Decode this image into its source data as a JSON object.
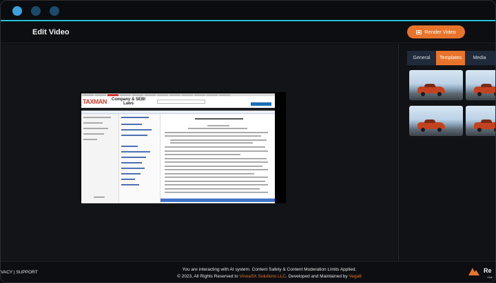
{
  "window": {
    "controls": [
      "close",
      "minimize",
      "maximize"
    ]
  },
  "header": {
    "title": "Edit Video",
    "render_label": "Render Video"
  },
  "preview": {
    "site": {
      "logo": "TAXMAN",
      "title_line1": "Company & SEBI",
      "title_line2": "Laws"
    }
  },
  "panel": {
    "tabs": [
      {
        "label": "General",
        "active": false
      },
      {
        "label": "Templates",
        "active": true
      },
      {
        "label": "Media",
        "active": false
      }
    ],
    "templates": [
      {
        "icon": "car-thumbnail"
      },
      {
        "icon": "car-thumbnail"
      },
      {
        "icon": "car-thumbnail"
      },
      {
        "icon": "car-thumbnail"
      }
    ]
  },
  "footer": {
    "links": "VACY | SUPPORT",
    "line1": "You are interacting with AI system. Content Safety & Content Moderation Limits Applied.",
    "line2_prefix": "© 2023, All Rights Reserved to ",
    "company": "VinoaSX Solutions LLC",
    "line2_middle": ". Developed and Maintained by ",
    "maintainer": "Vega6",
    "brand": "Re",
    "brand_sub": "Vide"
  },
  "colors": {
    "accent": "#e8742c",
    "titlebar_line": "#22c2d9",
    "tab_bg": "#1f2a3a"
  }
}
